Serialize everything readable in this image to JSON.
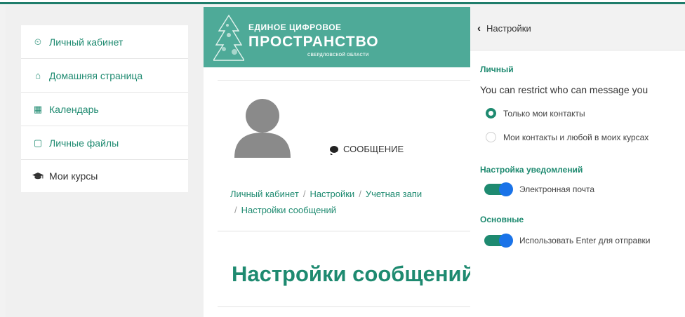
{
  "colors": {
    "brand": "#1e8a70",
    "banner": "#4eaa98",
    "toggle_knob": "#1a73e8"
  },
  "sidebar": {
    "items": [
      {
        "label": "Личный кабинет",
        "icon": "dashboard-icon",
        "glyph": "⏲"
      },
      {
        "label": "Домашняя страница",
        "icon": "home-icon",
        "glyph": "⌂"
      },
      {
        "label": "Календарь",
        "icon": "calendar-icon",
        "glyph": "▦"
      },
      {
        "label": "Личные файлы",
        "icon": "file-icon",
        "glyph": "▢"
      },
      {
        "label": "Мои курсы",
        "icon": "graduation-cap-icon",
        "glyph": "🎓"
      }
    ]
  },
  "banner": {
    "line1": "ЕДИНОЕ ЦИФРОВОЕ",
    "line2": "ПРОСТРАНСТВО",
    "line3": "СВЕРДЛОВСКОЙ ОБЛАСТИ"
  },
  "profile": {
    "message_label": "СООБЩЕНИЕ"
  },
  "breadcrumb": {
    "items": [
      "Личный кабинет",
      "Настройки",
      "Учетная запи",
      "Настройки сообщений"
    ]
  },
  "page_title": "Настройки сообщений",
  "drawer": {
    "back_label": "Настройки",
    "personal": {
      "title": "Личный",
      "restrict_text": "You can restrict who can message you",
      "options": [
        {
          "label": "Только мои контакты",
          "selected": true
        },
        {
          "label": "Мои контакты и любой в моих курсах",
          "selected": false
        }
      ]
    },
    "notifications": {
      "title": "Настройка уведомлений",
      "email_label": "Электронная почта",
      "email_on": true
    },
    "general": {
      "title": "Основные",
      "enter_label": "Использовать Enter для отправки",
      "enter_on": true
    }
  }
}
